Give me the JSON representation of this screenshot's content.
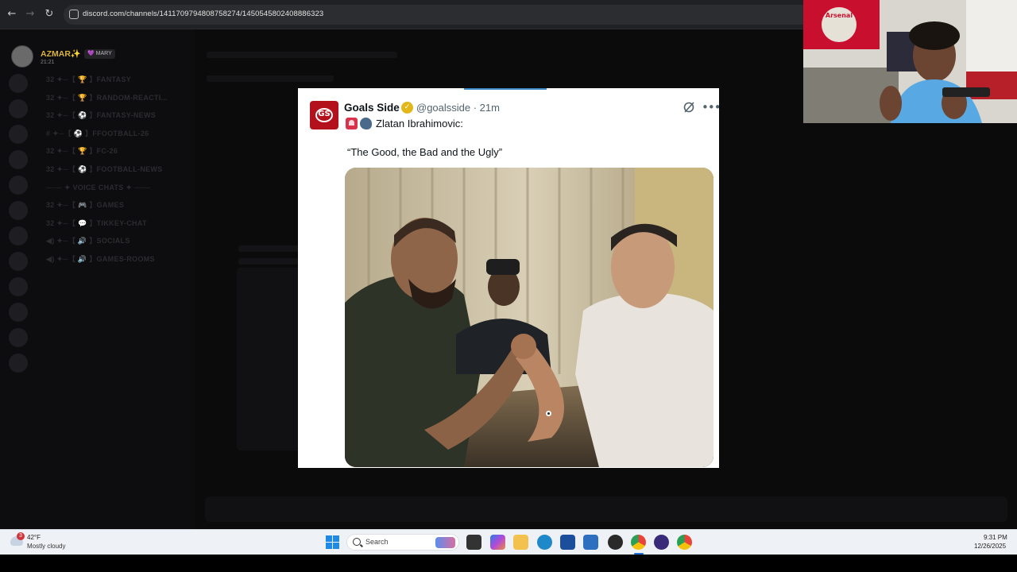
{
  "browser": {
    "url": "discord.com/channels/1411709794808758274/1450545802408886323"
  },
  "discord": {
    "profile": {
      "name": "AZMAR✨",
      "tag": "💜 MARY",
      "time": "21:21"
    },
    "channels": [
      "32 ✦─【 🏆 】FANTASY",
      "32 ✦─【 🏆 】RANDOM-REACTI...",
      "32 ✦─【 ⚽ 】FANTASY-NEWS",
      "# ✦─【 ⚽ 】FFOOTBALL-26",
      "32 ✦─【 🏆 】FC-26",
      "32 ✦─【 ⚽ 】FOOTBALL-NEWS",
      "─── ✦ VOICE CHATS ✦ ───",
      "32 ✦─【 🎮 】GAMES",
      "32 ✦─【 💬 】TIKKEY-CHAT",
      "◀) ✦─【 🔊 】SOCIALS",
      "◀) ✦─【 🔊 】GAMES-ROOMS"
    ]
  },
  "tweet": {
    "author": "Goals Side",
    "handle": "@goalsside · 21m",
    "line1": "Zlatan Ibrahimovic:",
    "quote": "“The Good, the Bad and the Ugly”",
    "logo_text": "GS"
  },
  "taskbar": {
    "weather_badge": "3",
    "weather_temp": "42°F",
    "weather_desc": "Mostly cloudy",
    "search_label": "Search",
    "time": "9:31 PM",
    "date": "12/26/2025"
  },
  "webcam": {
    "flag_text": "Arsenal"
  },
  "colors": {
    "accent": "#1e6fd9",
    "discord_bg": "#0b0b0c",
    "verified": "#e2b719",
    "brand_red": "#b3121d"
  }
}
